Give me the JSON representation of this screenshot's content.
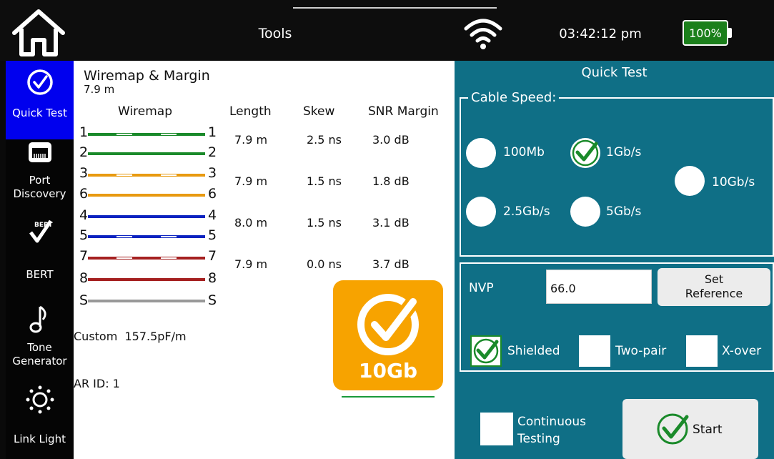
{
  "topbar": {
    "title": "Tools",
    "time": "03:42:12 pm",
    "battery": "100%"
  },
  "sidebar": {
    "items": [
      {
        "label": "Quick Test",
        "icon": "check-circle-icon",
        "active": true
      },
      {
        "label": "Port\nDiscovery",
        "icon": "ethernet-port-icon"
      },
      {
        "label": "BERT",
        "icon": "bert-check-icon",
        "icon_text": "BERT"
      },
      {
        "label": "Tone\nGenerator",
        "icon": "music-note-icon"
      },
      {
        "label": "Link Light",
        "icon": "light-icon"
      }
    ]
  },
  "main": {
    "title": "Wiremap & Margin",
    "subtitle": "7.9 m",
    "columns": [
      "Wiremap",
      "Length",
      "Skew",
      "SNR Margin"
    ],
    "pins": [
      "1",
      "2",
      "3",
      "6",
      "4",
      "5",
      "7",
      "8",
      "S"
    ],
    "wire_colors": [
      "#1a8a2a",
      "#e89a10",
      "#0a22c0",
      "#a52020",
      "#999999"
    ],
    "pairs": [
      {
        "length": "7.9 m",
        "skew": "2.5 ns",
        "snr": "3.0 dB"
      },
      {
        "length": "7.9 m",
        "skew": "1.5 ns",
        "snr": "1.8 dB"
      },
      {
        "length": "8.0 m",
        "skew": "1.5 ns",
        "snr": "3.1 dB"
      },
      {
        "length": "7.9 m",
        "skew": "0.0 ns",
        "snr": "3.7 dB"
      }
    ],
    "custom": "Custom  157.5pF/m",
    "ar_id": "AR ID: 1",
    "badge": "10Gb",
    "badge_color": "#f7a300"
  },
  "quick_test": {
    "title": "Quick Test",
    "cable_speed_label": "Cable Speed:",
    "speeds": {
      "s100": "100Mb",
      "s1g": "1Gb/s",
      "s10g": "10Gb/s",
      "s25g": "2.5Gb/s",
      "s5g": "5Gb/s"
    },
    "selected_speed": "1Gb/s",
    "nvp_label": "NVP",
    "nvp_value": "66.0",
    "set_reference": "Set\nReference",
    "shielded": "Shielded",
    "two_pair": "Two-pair",
    "x_over": "X-over",
    "continuous": "Continuous\nTesting",
    "start": "Start",
    "panel_color": "#0f6f86"
  }
}
